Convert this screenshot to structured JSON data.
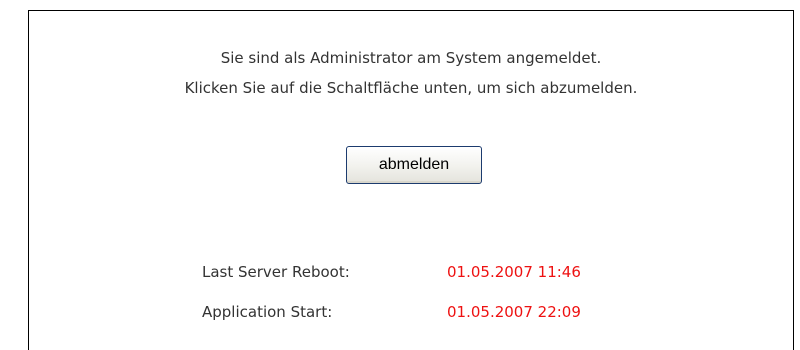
{
  "message": {
    "line1": "Sie sind als Administrator am System angemeldet.",
    "line2": "Klicken Sie auf die Schaltfläche unten, um sich abzumelden."
  },
  "logout_button": {
    "label": "abmelden"
  },
  "info": {
    "server_reboot": {
      "label": "Last Server Reboot:",
      "value": "01.05.2007 11:46"
    },
    "application_start": {
      "label": "Application Start:",
      "value": "01.05.2007 22:09"
    }
  },
  "colors": {
    "value_text": "#ee1111",
    "body_text": "#333333",
    "border": "#000000"
  }
}
